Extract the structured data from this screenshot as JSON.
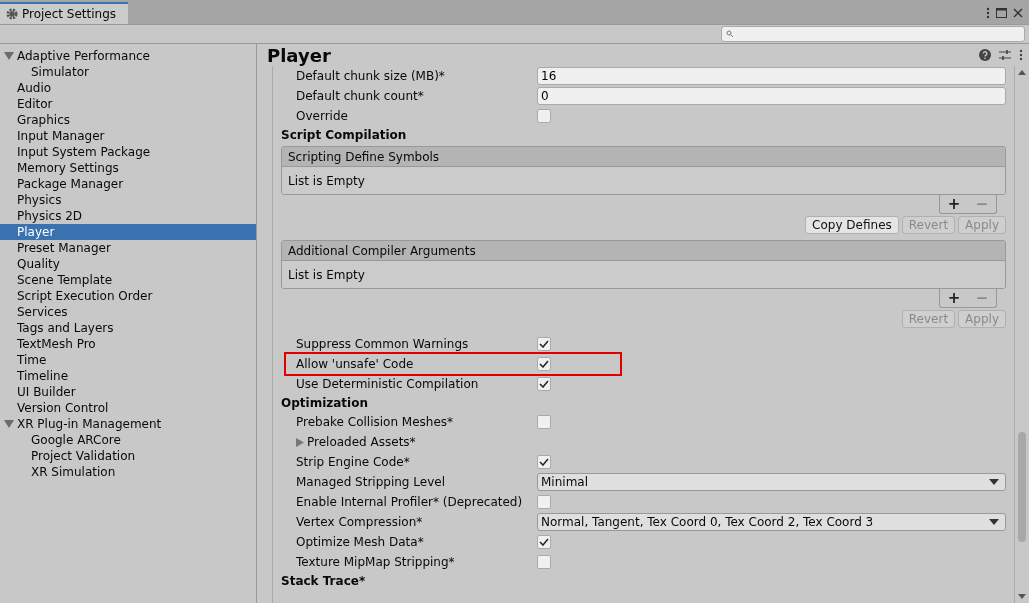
{
  "window": {
    "title": "Project Settings"
  },
  "sidebar": {
    "items": [
      {
        "label": "Adaptive Performance",
        "selected": false,
        "expanded": true,
        "children": [
          {
            "label": "Simulator",
            "selected": false
          }
        ]
      },
      {
        "label": "Audio",
        "selected": false
      },
      {
        "label": "Editor",
        "selected": false
      },
      {
        "label": "Graphics",
        "selected": false
      },
      {
        "label": "Input Manager",
        "selected": false
      },
      {
        "label": "Input System Package",
        "selected": false
      },
      {
        "label": "Memory Settings",
        "selected": false
      },
      {
        "label": "Package Manager",
        "selected": false
      },
      {
        "label": "Physics",
        "selected": false
      },
      {
        "label": "Physics 2D",
        "selected": false
      },
      {
        "label": "Player",
        "selected": true
      },
      {
        "label": "Preset Manager",
        "selected": false
      },
      {
        "label": "Quality",
        "selected": false
      },
      {
        "label": "Scene Template",
        "selected": false
      },
      {
        "label": "Script Execution Order",
        "selected": false
      },
      {
        "label": "Services",
        "selected": false
      },
      {
        "label": "Tags and Layers",
        "selected": false
      },
      {
        "label": "TextMesh Pro",
        "selected": false
      },
      {
        "label": "Time",
        "selected": false
      },
      {
        "label": "Timeline",
        "selected": false
      },
      {
        "label": "UI Builder",
        "selected": false
      },
      {
        "label": "Version Control",
        "selected": false
      },
      {
        "label": "XR Plug-in Management",
        "selected": false,
        "expanded": true,
        "children": [
          {
            "label": "Google ARCore",
            "selected": false
          },
          {
            "label": "Project Validation",
            "selected": false
          },
          {
            "label": "XR Simulation",
            "selected": false
          }
        ]
      }
    ]
  },
  "inspector": {
    "title": "Player",
    "rows": [
      {
        "kind": "field",
        "label": "Default chunk size (MB)*",
        "value": "16"
      },
      {
        "kind": "field",
        "label": "Default chunk count*",
        "value": "0"
      },
      {
        "kind": "checkbox",
        "label": "Override",
        "checked": false
      },
      {
        "kind": "header",
        "label": "Script Compilation"
      },
      {
        "kind": "list",
        "label": "Scripting Define Symbols",
        "empty_text": "List is Empty",
        "add": "+",
        "remove": "−",
        "buttons": [
          {
            "label": "Copy Defines",
            "disabled": false
          },
          {
            "label": "Revert",
            "disabled": true
          },
          {
            "label": "Apply",
            "disabled": true
          }
        ]
      },
      {
        "kind": "list",
        "label": "Additional Compiler Arguments",
        "empty_text": "List is Empty",
        "add": "+",
        "remove": "−",
        "buttons": [
          {
            "label": "Revert",
            "disabled": true
          },
          {
            "label": "Apply",
            "disabled": true
          }
        ]
      },
      {
        "kind": "checkbox",
        "label": "Suppress Common Warnings",
        "checked": true
      },
      {
        "kind": "checkbox",
        "label": "Allow 'unsafe' Code",
        "checked": true,
        "highlighted": true
      },
      {
        "kind": "checkbox",
        "label": "Use Deterministic Compilation",
        "checked": true
      },
      {
        "kind": "header",
        "label": "Optimization"
      },
      {
        "kind": "checkbox",
        "label": "Prebake Collision Meshes*",
        "checked": false
      },
      {
        "kind": "foldout",
        "label": "Preloaded Assets*",
        "expanded": false
      },
      {
        "kind": "checkbox",
        "label": "Strip Engine Code*",
        "checked": true
      },
      {
        "kind": "dropdown",
        "label": "Managed Stripping Level",
        "value": "Minimal"
      },
      {
        "kind": "checkbox",
        "label": "Enable Internal Profiler* (Deprecated)",
        "checked": false
      },
      {
        "kind": "dropdown",
        "label": "Vertex Compression*",
        "value": "Normal, Tangent, Tex Coord 0, Tex Coord 2, Tex Coord 3"
      },
      {
        "kind": "checkbox",
        "label": "Optimize Mesh Data*",
        "checked": true
      },
      {
        "kind": "checkbox",
        "label": "Texture MipMap Stripping*",
        "checked": false
      },
      {
        "kind": "header",
        "label": "Stack Trace*"
      }
    ]
  }
}
